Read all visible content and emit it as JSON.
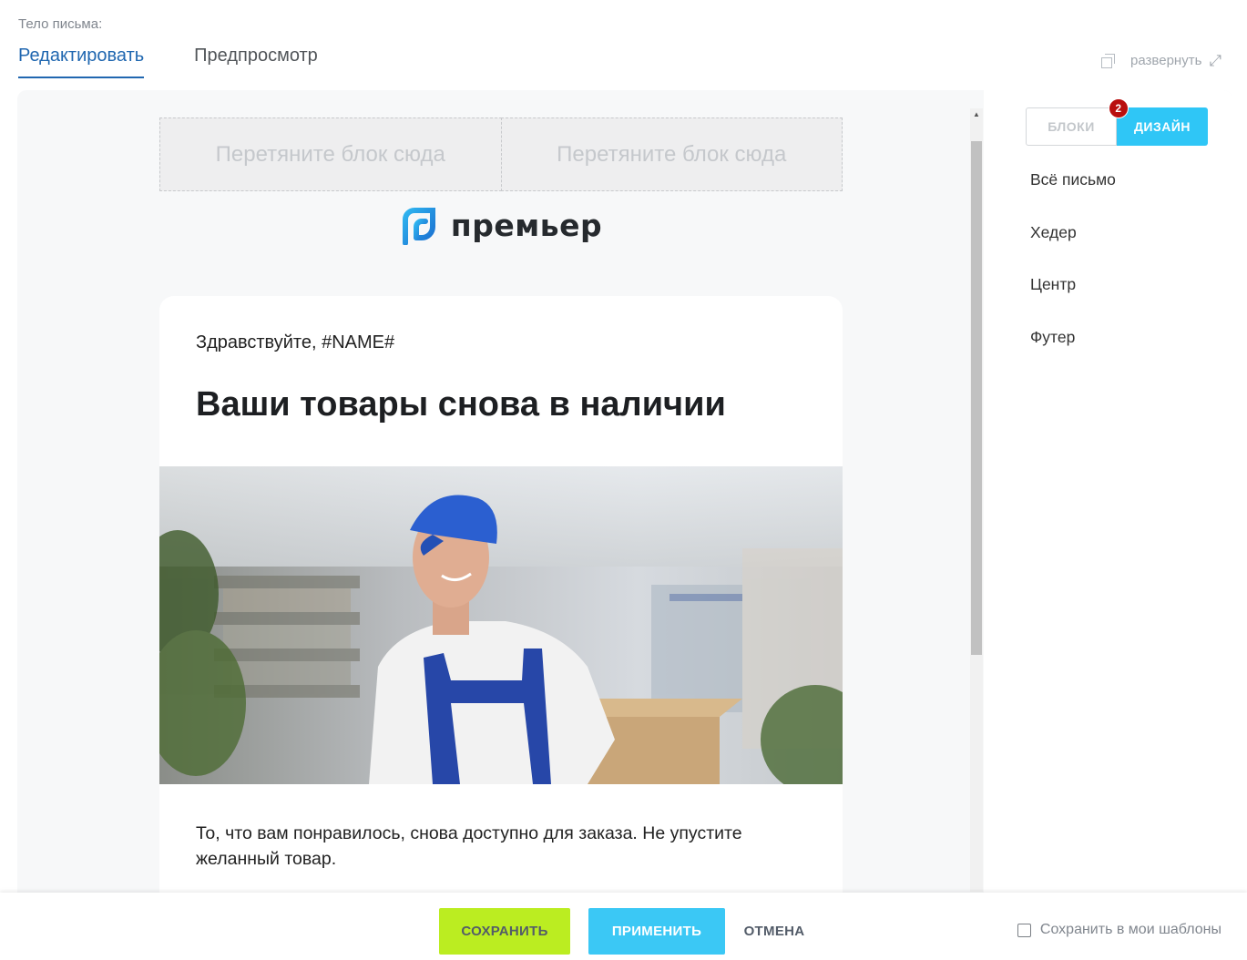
{
  "field_label": "Тело письма:",
  "tabs": [
    {
      "label": "Редактировать",
      "active": true
    },
    {
      "label": "Предпросмотр",
      "active": false
    }
  ],
  "expand_label": "развернуть",
  "email": {
    "drop_placeholders": [
      "Перетяните блок сюда",
      "Перетяните блок сюда"
    ],
    "logo_text": "премьер",
    "greeting": "Здравствуйте, #NAME#",
    "headline": "Ваши товары снова в наличии",
    "body": "То, что вам понравилось, снова доступно для заказа. Не упустите желанный товар."
  },
  "panel": {
    "blocks_label": "БЛОКИ",
    "design_label": "ДИЗАЙН",
    "badge_count": "2",
    "design_items": [
      "Всё письмо",
      "Хедер",
      "Центр",
      "Футер"
    ]
  },
  "footer": {
    "save_label": "СОХРАНИТЬ",
    "apply_label": "ПРИМЕНИТЬ",
    "cancel_label": "ОТМЕНА",
    "save_template_label": "Сохранить в мои шаблоны",
    "save_template_checked": false
  },
  "colors": {
    "accent_blue": "#2067b0",
    "save_green": "#bbed21",
    "apply_cyan": "#3bc8f5",
    "badge_red": "#b90f0f"
  }
}
